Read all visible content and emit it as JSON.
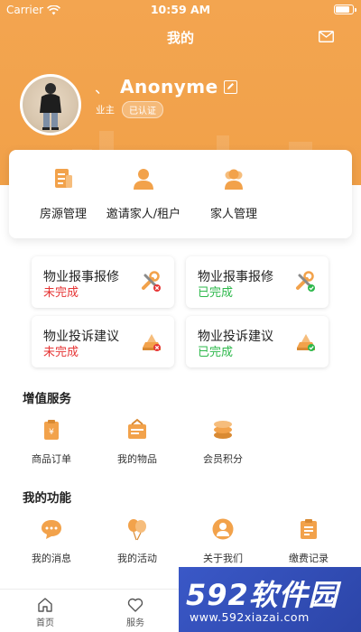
{
  "status_bar": {
    "carrier": "Carrier",
    "time": "10:59 AM",
    "battery_level": 0.9
  },
  "header": {
    "title": "我的"
  },
  "profile": {
    "separator": "、",
    "username": "Anonyme",
    "role": "业主",
    "verified": "已认证"
  },
  "quick_actions": [
    {
      "label": "房源管理",
      "icon": "document-icon"
    },
    {
      "label": "邀请家人/租户",
      "icon": "person-icon"
    },
    {
      "label": "家人管理",
      "icon": "group-icon"
    }
  ],
  "status_cards": [
    {
      "title": "物业报事报修",
      "state": "未完成",
      "status": "pending",
      "icon": "repair-icon"
    },
    {
      "title": "物业报事报修",
      "state": "已完成",
      "status": "done",
      "icon": "repair-icon"
    },
    {
      "title": "物业投诉建议",
      "state": "未完成",
      "status": "pending",
      "icon": "complaint-icon"
    },
    {
      "title": "物业投诉建议",
      "state": "已完成",
      "status": "done",
      "icon": "complaint-icon"
    }
  ],
  "value_added": {
    "title": "增值服务",
    "items": [
      {
        "label": "商品订单",
        "icon": "order-icon"
      },
      {
        "label": "我的物品",
        "icon": "box-icon"
      },
      {
        "label": "会员积分",
        "icon": "coins-icon"
      }
    ]
  },
  "functions": {
    "title": "我的功能",
    "items": [
      {
        "label": "我的消息",
        "icon": "chat-icon"
      },
      {
        "label": "我的活动",
        "icon": "balloon-icon"
      },
      {
        "label": "关于我们",
        "icon": "user-circle-icon"
      },
      {
        "label": "缴费记录",
        "icon": "clipboard-icon"
      }
    ]
  },
  "tabbar": [
    {
      "label": "首页",
      "icon": "home-icon"
    },
    {
      "label": "服务",
      "icon": "heart-icon"
    }
  ],
  "watermark": {
    "brand_num": "592",
    "brand_text": "软件园",
    "url": "www.592xiazai.com"
  },
  "colors": {
    "accent": "#F2A24B",
    "pending": "#E63535",
    "done": "#2DB84B"
  }
}
